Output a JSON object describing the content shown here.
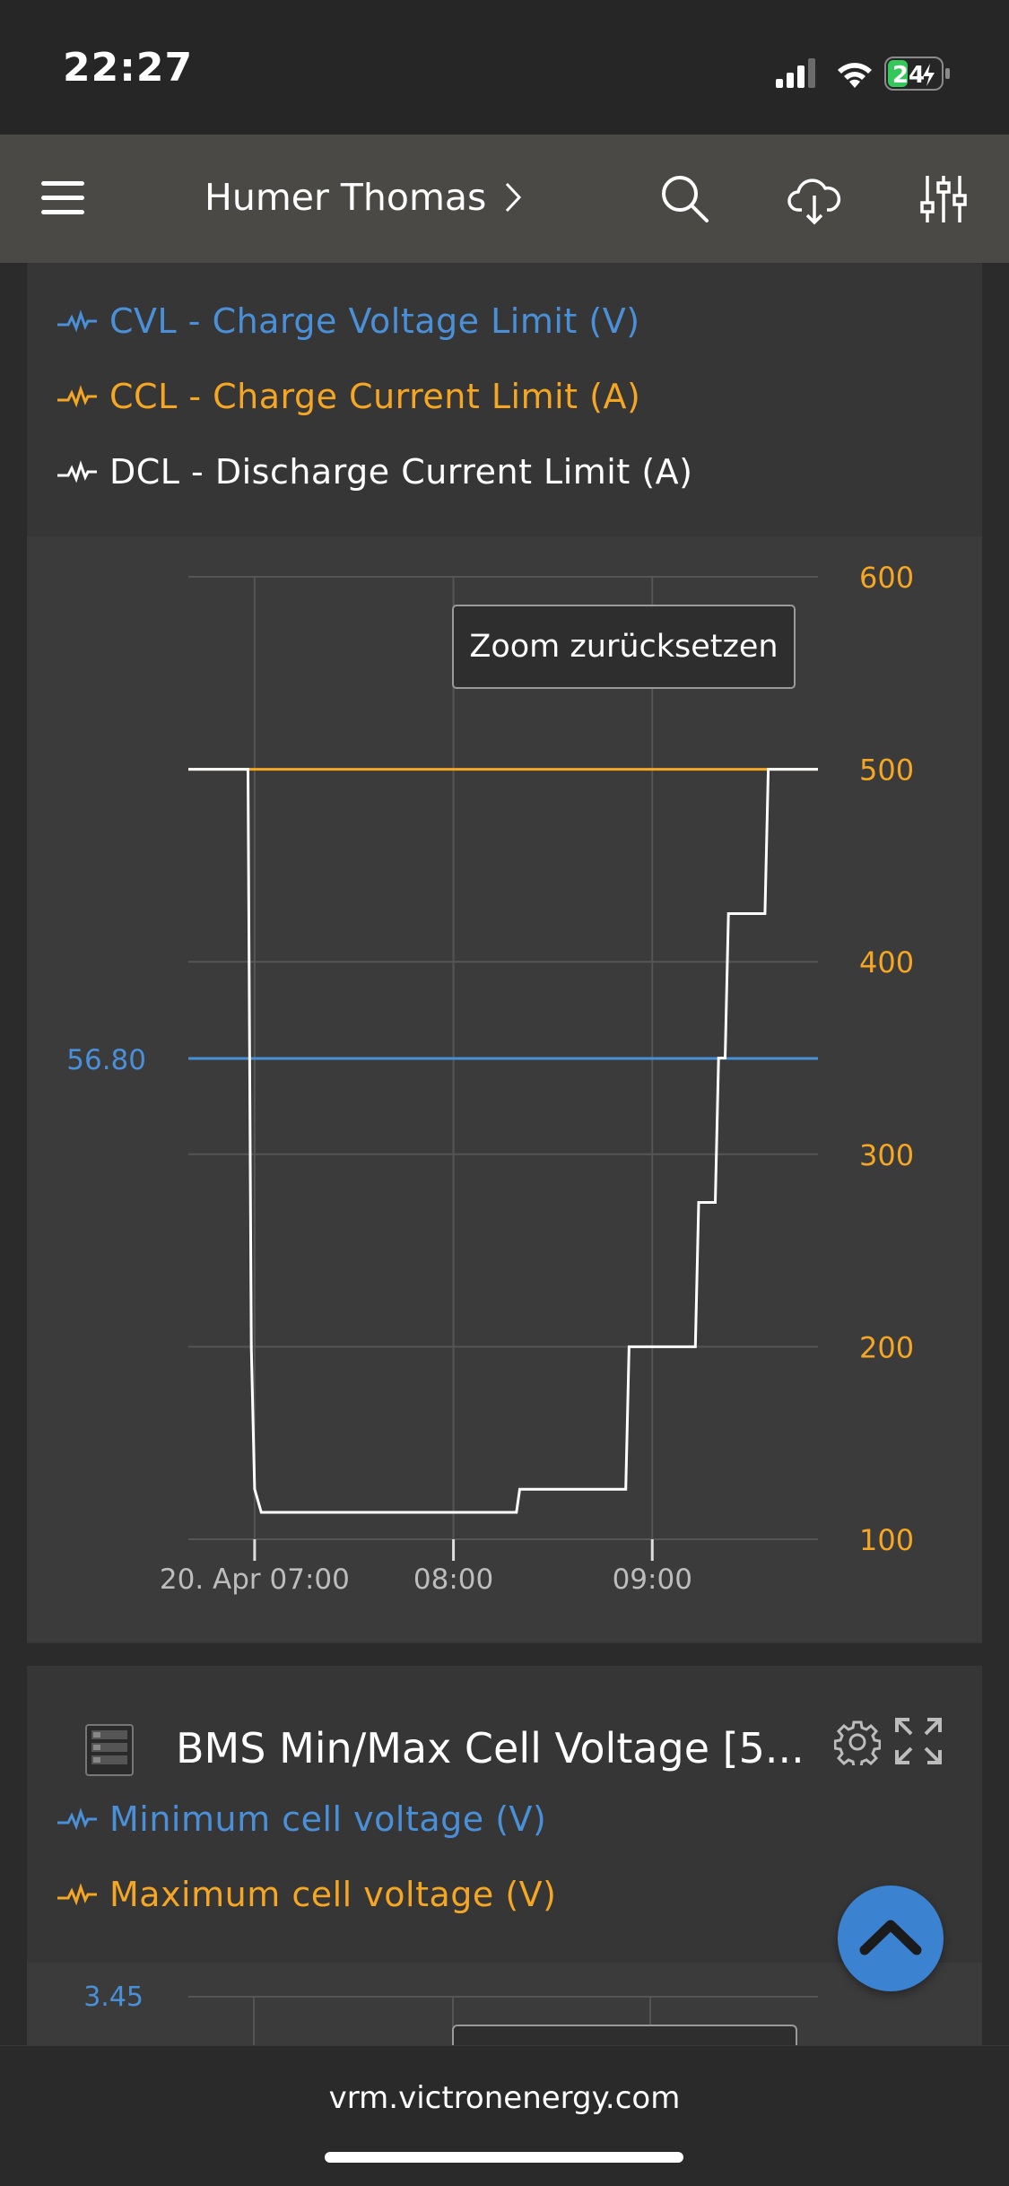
{
  "status_bar": {
    "time": "22:27",
    "battery": "24"
  },
  "nav": {
    "account_name": "Humer Thomas",
    "icons": [
      "menu-icon",
      "chevron-right-icon",
      "search-icon",
      "cloud-download-icon",
      "sliders-icon"
    ]
  },
  "chart1": {
    "legend": [
      {
        "label": "CVL - Charge Voltage Limit (V)",
        "color": "#4a90d9"
      },
      {
        "label": "CCL - Charge Current Limit (A)",
        "color": "#f5a623"
      },
      {
        "label": "DCL - Discharge Current Limit (A)",
        "color": "#ffffff"
      }
    ],
    "zoom_reset_label": "Zoom zurücksetzen",
    "left_axis_value": "56.80",
    "right_axis_ticks": [
      "600",
      "500",
      "400",
      "300",
      "200",
      "100"
    ],
    "x_ticks": [
      "20. Apr 07:00",
      "08:00",
      "09:00"
    ]
  },
  "chart_data": {
    "type": "line",
    "x_unit": "time (20. Apr)",
    "xlim": [
      "06:40",
      "09:50"
    ],
    "right_axis": {
      "ylim": [
        100,
        600
      ],
      "ticks": [
        100,
        200,
        300,
        400,
        500,
        600
      ],
      "color": "#f5a623"
    },
    "left_axis_label_value": 56.8,
    "x_ticks": [
      "20. Apr 07:00",
      "08:00",
      "09:00"
    ],
    "series": [
      {
        "name": "CVL - Charge Voltage Limit (V)",
        "color": "#4a90d9",
        "axis": "left",
        "points": [
          [
            "06:40",
            56.8
          ],
          [
            "09:50",
            56.8
          ]
        ]
      },
      {
        "name": "CCL - Charge Current Limit (A)",
        "color": "#f5a623",
        "axis": "right",
        "points": [
          [
            "06:40",
            500
          ],
          [
            "09:50",
            500
          ]
        ]
      },
      {
        "name": "DCL - Discharge Current Limit (A)",
        "color": "#ffffff",
        "axis": "right",
        "points": [
          [
            "06:40",
            500
          ],
          [
            "06:58",
            500
          ],
          [
            "06:59",
            200
          ],
          [
            "07:00",
            126
          ],
          [
            "07:02",
            114
          ],
          [
            "08:19",
            114
          ],
          [
            "08:20",
            126
          ],
          [
            "08:52",
            126
          ],
          [
            "08:53",
            200
          ],
          [
            "09:13",
            200
          ],
          [
            "09:14",
            275
          ],
          [
            "09:19",
            275
          ],
          [
            "09:20",
            350
          ],
          [
            "09:22",
            350
          ],
          [
            "09:23",
            425
          ],
          [
            "09:34",
            425
          ],
          [
            "09:35",
            500
          ],
          [
            "09:50",
            500
          ]
        ]
      }
    ],
    "grid": true
  },
  "chart2": {
    "title": "BMS Min/Max Cell Voltage [5...",
    "legend": [
      {
        "label": "Minimum cell voltage (V)",
        "color": "#4a90d9"
      },
      {
        "label": "Maximum cell voltage (V)",
        "color": "#f5a623"
      }
    ],
    "left_axis_value": "3.45"
  },
  "browser": {
    "url": "vrm.victronenergy.com"
  }
}
